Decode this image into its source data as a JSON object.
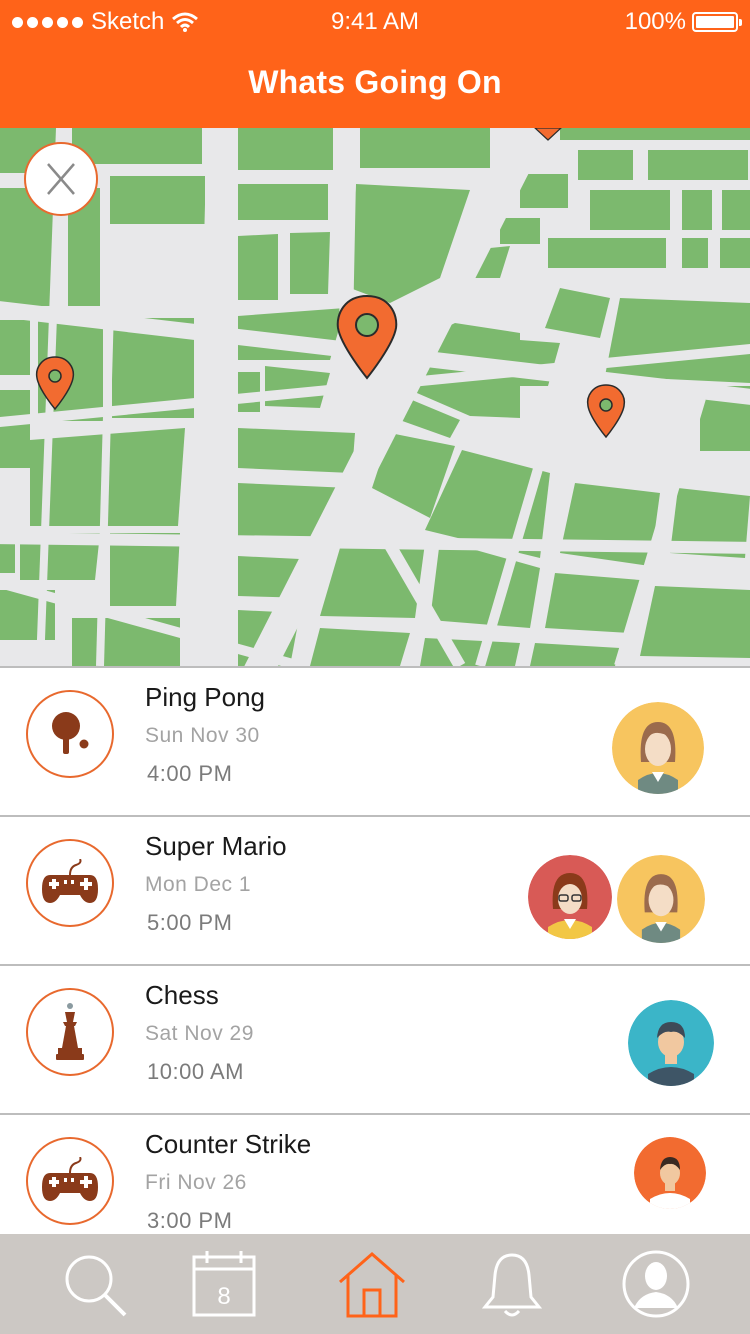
{
  "status_bar": {
    "carrier": "Sketch",
    "time": "9:41 AM",
    "battery": "100%"
  },
  "header": {
    "title": "Whats Going On"
  },
  "map": {
    "close_label": "X",
    "pin_color": "#f26b30",
    "land_color": "#7cb96e",
    "road_color": "#e8e8ea"
  },
  "events": [
    {
      "name": "Ping Pong",
      "date": "Sun  Nov 30",
      "time": "4:00 PM",
      "icon": "ping-pong-paddle-icon",
      "attendees": [
        "female-avatar-yellow"
      ]
    },
    {
      "name": "Super Mario",
      "date": "Mon  Dec 1",
      "time": "5:00 PM",
      "icon": "gamepad-icon",
      "attendees": [
        "female-avatar-red",
        "female-avatar-yellow"
      ]
    },
    {
      "name": "Chess",
      "date": "Sat  Nov 29",
      "time": "10:00 AM",
      "icon": "chess-king-icon",
      "attendees": [
        "male-avatar-teal"
      ]
    },
    {
      "name": "Counter Strike",
      "date": "Fri  Nov 26",
      "time": "3:00 PM",
      "icon": "gamepad-icon",
      "attendees": [
        "male-avatar-orange"
      ]
    }
  ],
  "tabbar": {
    "calendar_day": "8",
    "active_tab": "home",
    "tabs": [
      "search-icon",
      "calendar-icon",
      "home-icon",
      "bell-icon",
      "profile-icon"
    ],
    "active_color": "#ff6319"
  },
  "colors": {
    "accent": "#ff6319",
    "icon_brown": "#8a3a1a"
  }
}
